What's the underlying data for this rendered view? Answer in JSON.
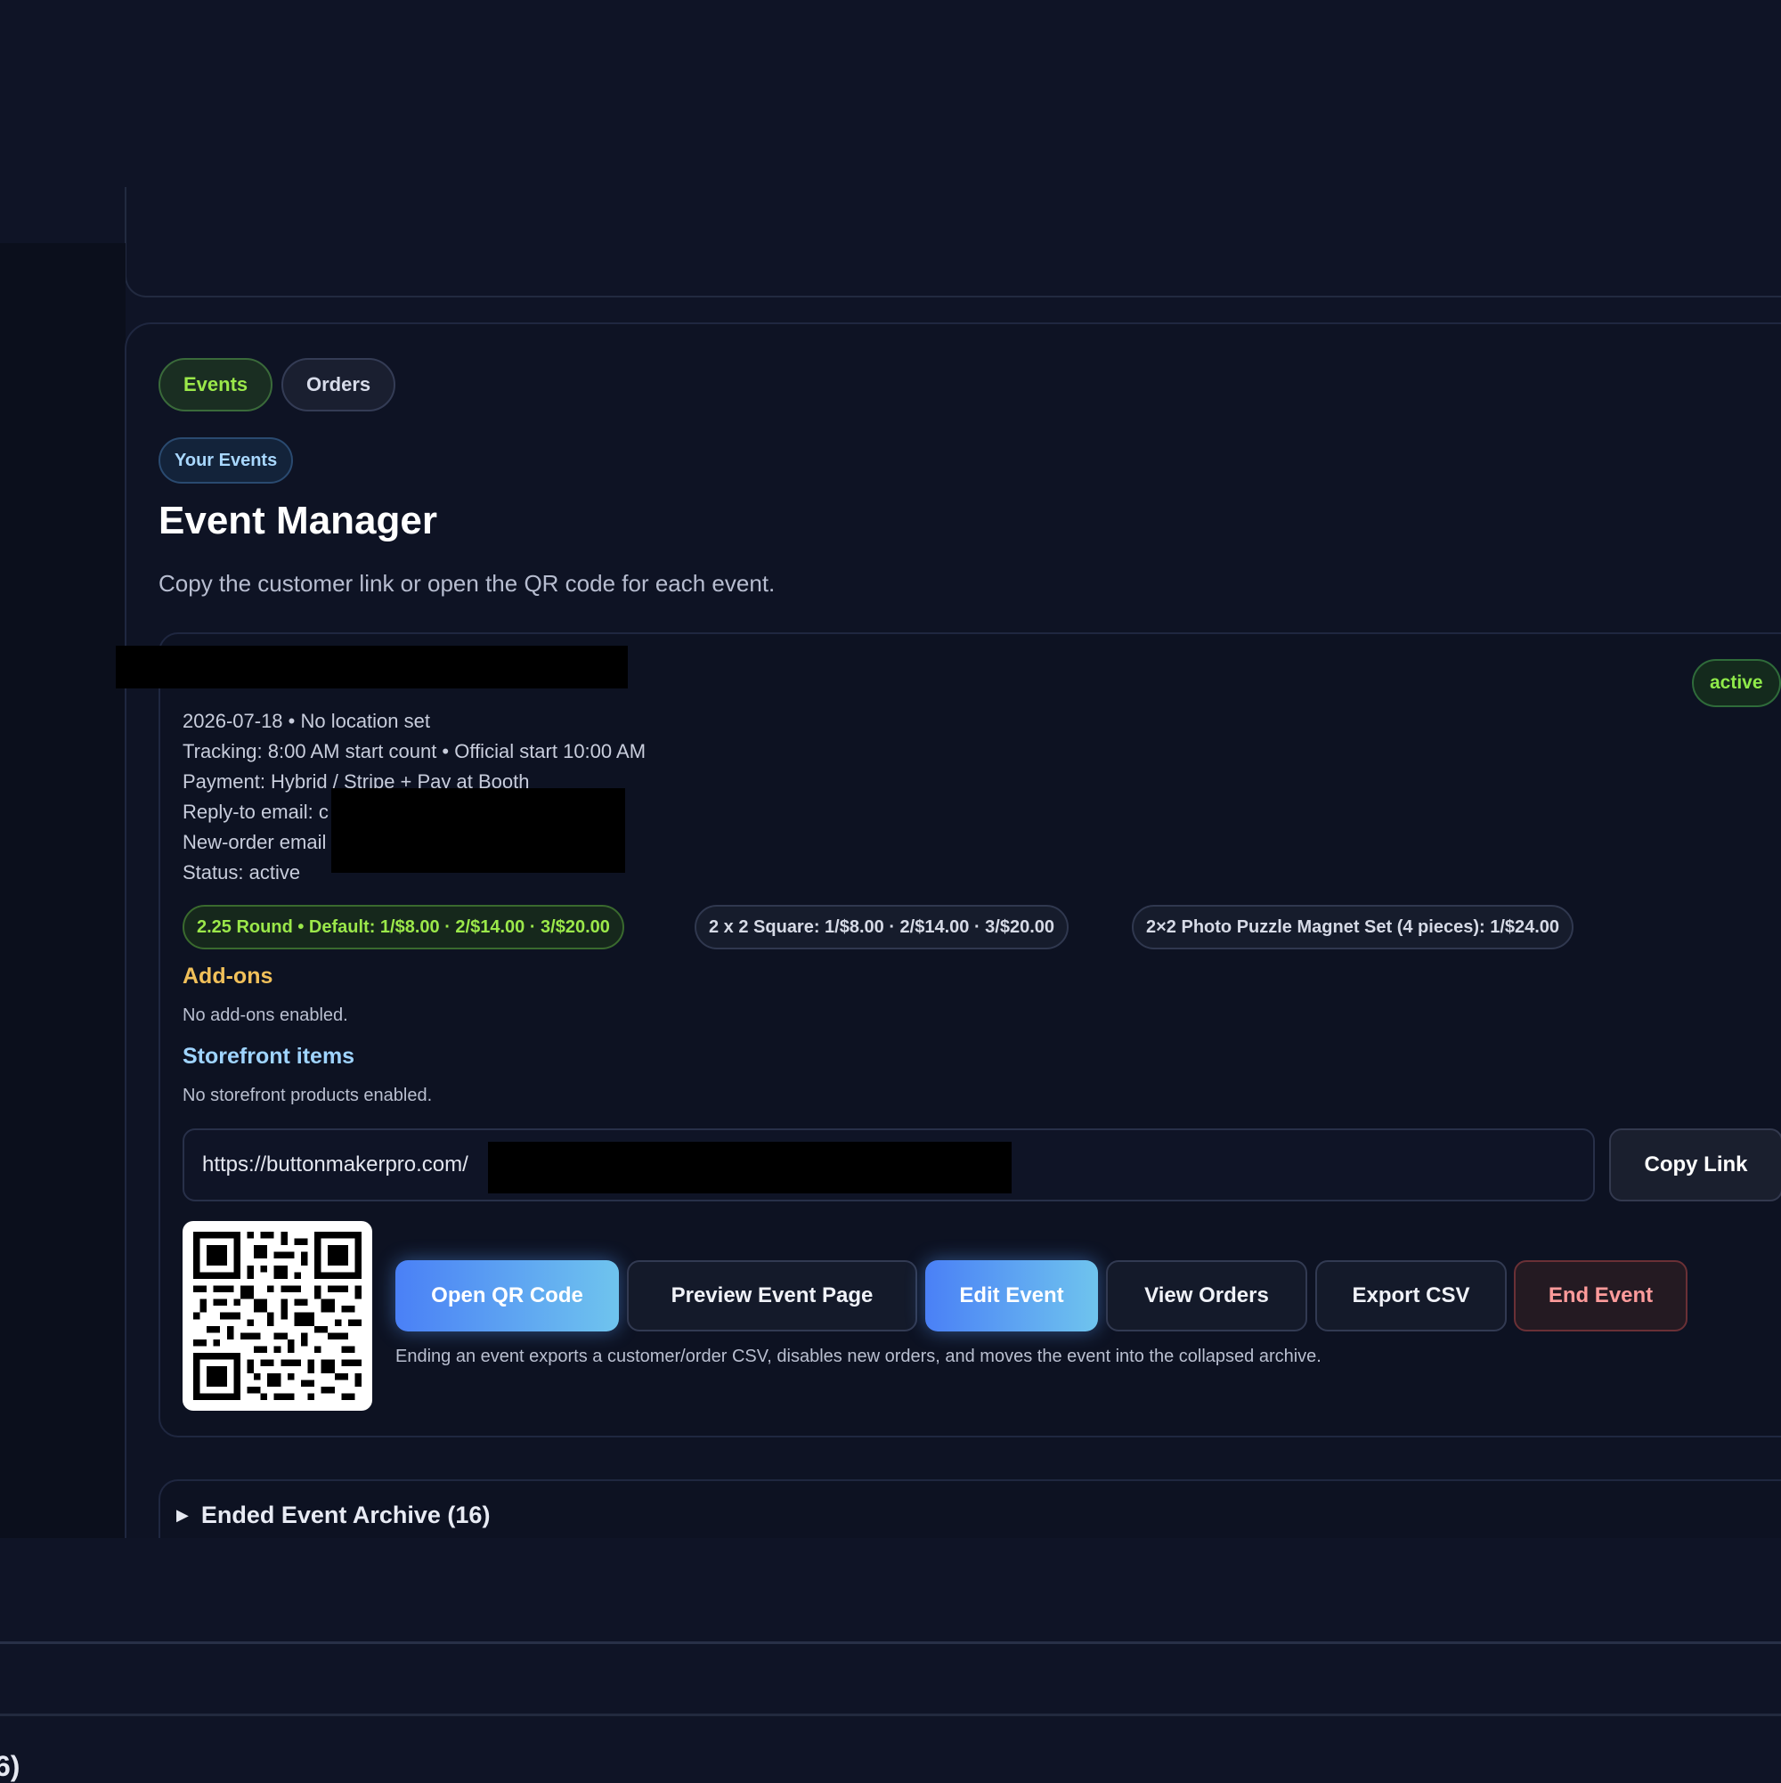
{
  "tabs": [
    {
      "label": "Events",
      "active": true
    },
    {
      "label": "Orders",
      "active": false
    }
  ],
  "section_pill": "Your Events",
  "page": {
    "title": "Event Manager",
    "subtitle": "Copy the customer link or open the QR code for each event."
  },
  "event": {
    "status_badge": "active",
    "meta": {
      "date_location": "2026-07-18 • No location set",
      "tracking": "Tracking: 8:00 AM start count • Official start 10:00 AM",
      "payment": "Payment: Hybrid / Stripe + Pay at Booth",
      "reply_to": "Reply-to email: c",
      "new_order": "New-order email",
      "status": "Status: active"
    },
    "pricing": [
      "2.25 Round • Default: 1/$8.00 · 2/$14.00 · 3/$20.00",
      "2 x 2 Square: 1/$8.00 · 2/$14.00 · 3/$20.00",
      "2×2 Photo Puzzle Magnet Set (4 pieces): 1/$24.00"
    ],
    "addons_heading": "Add-ons",
    "addons_note": "No add-ons enabled.",
    "storefront_heading": "Storefront items",
    "storefront_note": "No storefront products enabled.",
    "link_value": "https://buttonmakerpro.com/",
    "copy_link": "Copy Link",
    "actions": {
      "open_qr": "Open QR Code",
      "preview": "Preview Event Page",
      "edit": "Edit Event",
      "view_orders": "View Orders",
      "export_csv": "Export CSV",
      "end_event": "End Event"
    },
    "end_note": "Ending an event exports a customer/order CSV, disables new orders, and moves the event into the collapsed archive."
  },
  "archive": {
    "toggle_icon": "▶",
    "label": "Ended Event Archive (16)"
  },
  "bottom_cut_text": "6)",
  "colors": {
    "background": "#0f1426",
    "accent_green": "#9be84a",
    "accent_blue": "#4a80f6",
    "addons_heading": "#f1c05a",
    "storefront_heading": "#9fd4ff",
    "danger": "#ff9b9b"
  }
}
